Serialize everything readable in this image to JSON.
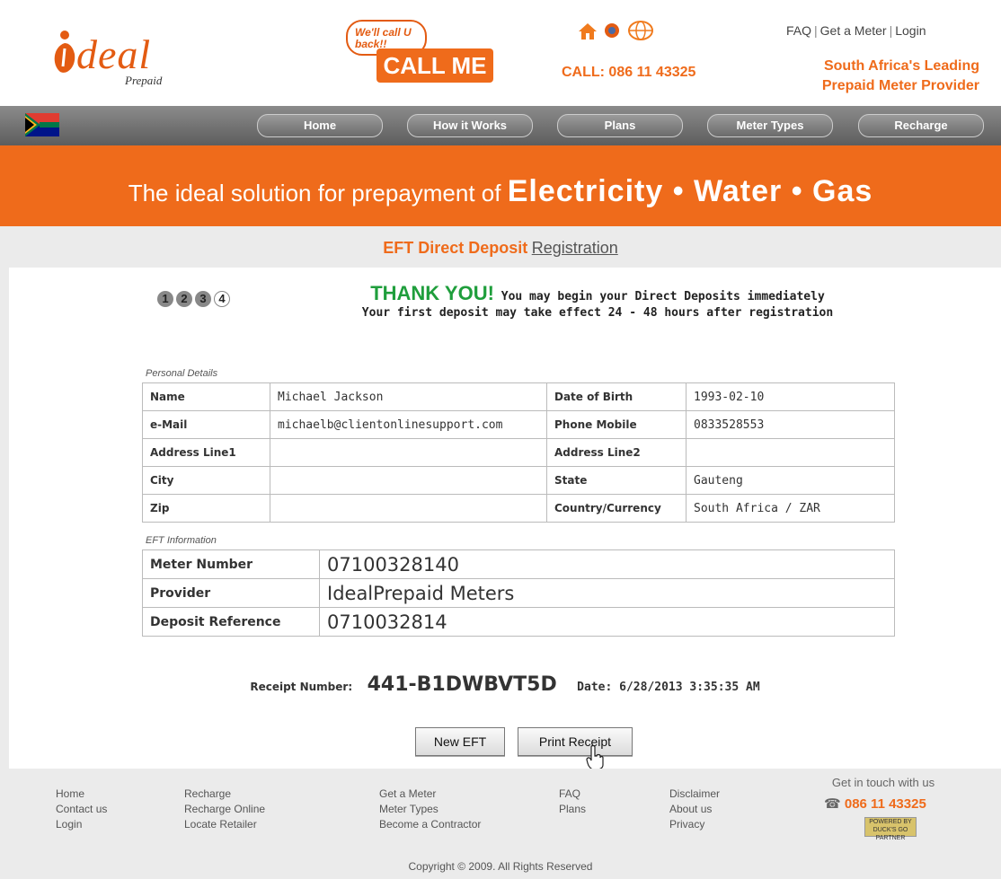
{
  "header": {
    "logo_text": "deal",
    "logo_sub": "Prepaid",
    "callback_bubble": "We'll call U back!!",
    "callme_label": "CALL ME",
    "call_number": "CALL: 086 11 43325",
    "top_links": [
      "FAQ",
      "Get a Meter",
      "Login"
    ],
    "tagline_line1": "South Africa's Leading",
    "tagline_line2": "Prepaid Meter Provider"
  },
  "nav": {
    "items": [
      "Home",
      "How it Works",
      "Plans",
      "Meter Types",
      "Recharge"
    ]
  },
  "banner": {
    "prefix": "The ideal solution for prepayment of ",
    "big": "Electricity • Water  • Gas"
  },
  "page_title": {
    "eft": "EFT Direct Deposit",
    "registration": "Registration"
  },
  "steps": [
    "1",
    "2",
    "3",
    "4"
  ],
  "thanks": {
    "big": "THANK YOU!",
    "line1": "You may begin your Direct Deposits immediately",
    "line2": "Your first deposit may take effect 24 - 48  hours after registration"
  },
  "personal": {
    "section_label": "Personal Details",
    "rows": [
      [
        "Name",
        "Michael Jackson",
        "Date of Birth",
        "1993-02-10"
      ],
      [
        "e-Mail",
        "michaelb@clientonlinesupport.com",
        "Phone Mobile",
        "0833528553"
      ],
      [
        "Address Line1",
        "",
        "Address Line2",
        ""
      ],
      [
        "City",
        "",
        "State",
        "Gauteng"
      ],
      [
        "Zip",
        "",
        "Country/Currency",
        "South Africa / ZAR"
      ]
    ]
  },
  "eft": {
    "section_label": "EFT Information",
    "rows": [
      [
        "Meter Number",
        "07100328140"
      ],
      [
        "Provider",
        "IdealPrepaid Meters"
      ],
      [
        "Deposit Reference",
        "0710032814"
      ]
    ]
  },
  "receipt": {
    "label": "Receipt Number:",
    "number": "441-B1DWBVT5D",
    "date": "Date: 6/28/2013 3:35:35 AM"
  },
  "buttons": {
    "new_eft": "New EFT",
    "print_receipt": "Print Receipt"
  },
  "footer": {
    "col1": [
      "Home",
      "Contact us",
      "Login"
    ],
    "col2": [
      "Recharge",
      "Recharge Online",
      "Locate Retailer"
    ],
    "col3": [
      "Get a Meter",
      "Meter Types",
      "Become a Contractor"
    ],
    "col4": [
      "FAQ",
      "Plans"
    ],
    "col5": [
      "Disclaimer",
      "About us",
      "Privacy"
    ],
    "get_in_touch": "Get in touch with us",
    "phone": "086 11 43325",
    "copyright": "Copyright © 2009. All Rights Reserved"
  },
  "colors": {
    "brand_orange": "#ef6b1b",
    "thanks_green": "#1f9e3c"
  }
}
